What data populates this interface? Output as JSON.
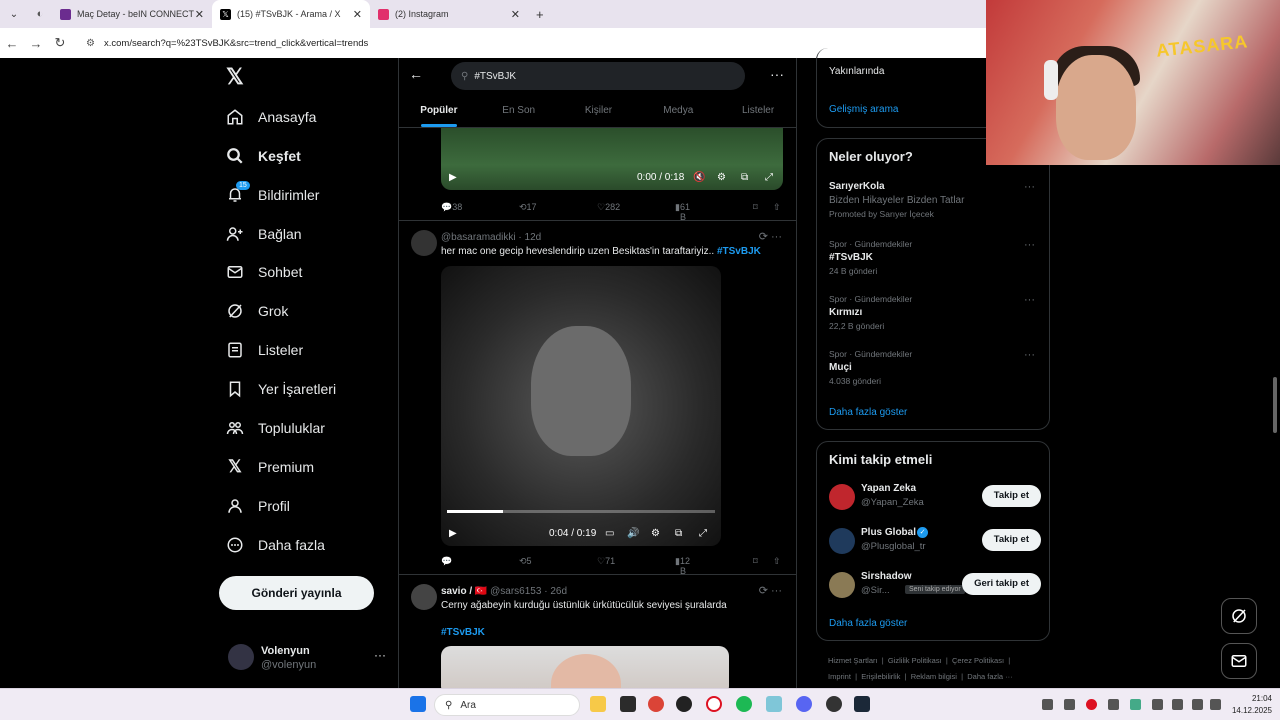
{
  "browser": {
    "tabs": [
      {
        "label": "Maç Detay - beIN CONNECT",
        "color": "#6b2c8f"
      },
      {
        "label": "(15) #TSvBJK - Arama / X",
        "color": "#000000"
      },
      {
        "label": "(2) Instagram",
        "color": "#e1306c"
      }
    ],
    "new_tab": "+",
    "url": "x.com/search?q=%23TSvBJK&src=trend_click&vertical=trends"
  },
  "nav": {
    "items": [
      {
        "label": "Anasayfa"
      },
      {
        "label": "Keşfet"
      },
      {
        "label": "Bildirimler",
        "badge": "15"
      },
      {
        "label": "Bağlan"
      },
      {
        "label": "Sohbet"
      },
      {
        "label": "Grok"
      },
      {
        "label": "Listeler"
      },
      {
        "label": "Yer İşaretleri"
      },
      {
        "label": "Topluluklar"
      },
      {
        "label": "Premium"
      },
      {
        "label": "Profil"
      },
      {
        "label": "Daha fazla"
      }
    ],
    "post_button": "Gönderi yayınla",
    "user": {
      "name": "Volenyun",
      "handle": "@volenyun"
    }
  },
  "search": {
    "query": "#TSvBJK"
  },
  "tabs": [
    "Popüler",
    "En Son",
    "Kişiler",
    "Medya",
    "Listeler"
  ],
  "posts": [
    {
      "video_time": "0:00 / 0:18",
      "stats": {
        "replies": "38",
        "reposts": "17",
        "likes": "282",
        "views": "61 B"
      }
    },
    {
      "author": "",
      "handle": "@basaramadikki",
      "time": "12d",
      "text": "her mac one gecip heveslendirip uzen Besiktas'in taraftariyiz..",
      "hashtag": "#TSvBJK",
      "video_time": "0:04 / 0:19",
      "progress": 0.21,
      "stats": {
        "replies": "",
        "reposts": "5",
        "likes": "71",
        "views": "12 B"
      }
    },
    {
      "author": "savio / 🇹🇷",
      "handle": "@sars6153",
      "time": "26d",
      "text": "Cerny ağabeyin kurduğu üstünlük ürkütücülük seviyesi şuralarda",
      "hashtag": "#TSvBJK"
    }
  ],
  "right": {
    "top_item": "Yakınlarında",
    "advanced_search": "Gelişmiş arama",
    "trends_title": "Neler oluyor?",
    "promoted": {
      "name": "SarıyerKola",
      "desc": "Bizden Hikayeler Bizden Tatlar",
      "note": "Promoted by Sarıyer İçecek"
    },
    "trends": [
      {
        "cat": "Spor · Gündemdekiler",
        "name": "#TSvBJK",
        "count": "24 B gönderi"
      },
      {
        "cat": "Spor · Gündemdekiler",
        "name": "Kırmızı",
        "count": "22,2 B gönderi"
      },
      {
        "cat": "Spor · Gündemdekiler",
        "name": "Muçi",
        "count": "4.038 gönderi"
      }
    ],
    "show_more": "Daha fazla göster",
    "who_title": "Kimi takip etmeli",
    "who": [
      {
        "name": "Yapan Zeka",
        "handle": "@Yapan_Zeka",
        "button": "Takip et",
        "color": "#c0262d"
      },
      {
        "name": "Plus Global",
        "handle": "@Plusglobal_tr",
        "button": "Takip et",
        "color": "#1f3a5c"
      },
      {
        "name": "Sirshadow",
        "handle": "@Sir...",
        "button": "Geri takip et",
        "color": "#8a7a55",
        "follows_you": "Seni takip ediyor"
      }
    ],
    "who_more": "Daha fazla göster",
    "footer": [
      "Hizmet Şartları",
      "Gizlilik Politikası",
      "Çerez Politikası",
      "Imprint",
      "Erişilebilirlik",
      "Reklam bilgisi",
      "Daha fazla ···"
    ]
  },
  "webcam": {
    "banner": "ATASARA"
  },
  "taskbar": {
    "search": "Ara",
    "time": "21:04",
    "date": "14.12.2025"
  }
}
